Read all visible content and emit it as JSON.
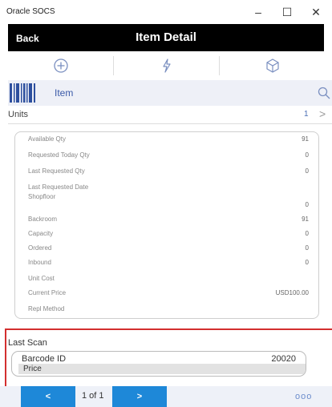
{
  "window": {
    "app_title": "Oracle SOCS",
    "minimize": "–",
    "maximize": "☐",
    "close": "✕"
  },
  "header": {
    "back_label": "Back",
    "title": "Item Detail"
  },
  "toolbar": {
    "icons": [
      "plus-circle-icon",
      "lightning-icon",
      "cube-icon"
    ],
    "accent": "#7a8fc0"
  },
  "search": {
    "label": "Item"
  },
  "units": {
    "label": "Units",
    "count": "1",
    "chevron": ">"
  },
  "details": {
    "available_qty": {
      "label": "Available Qty",
      "value": "91"
    },
    "requested_today_qty": {
      "label": "Requested Today Qty",
      "value": "0"
    },
    "last_requested_qty": {
      "label": "Last Requested Qty",
      "value": "0"
    },
    "last_requested_date": {
      "label": "Last Requested Date",
      "value": ""
    },
    "shopfloor": {
      "label": "Shopfloor",
      "value": "0"
    },
    "backroom": {
      "label": "Backroom",
      "value": "91"
    },
    "capacity": {
      "label": "Capacity",
      "value": "0"
    },
    "ordered": {
      "label": "Ordered",
      "value": "0"
    },
    "inbound": {
      "label": "Inbound",
      "value": "0"
    },
    "unit_cost": {
      "label": "Unit Cost",
      "value": ""
    },
    "current_price": {
      "label": "Current Price",
      "value": "USD100.00"
    },
    "repl_method": {
      "label": "Repl Method",
      "value": ""
    }
  },
  "last_scan": {
    "title": "Last Scan",
    "barcode_label": "Barcode ID",
    "barcode_value": "20020",
    "price_label": "Price",
    "highlight_color": "#d32f2f"
  },
  "pager": {
    "prev_label": "<",
    "page_info": "1 of 1",
    "next_label": ">",
    "more_label": "ooo",
    "button_color": "#1e88d8"
  }
}
